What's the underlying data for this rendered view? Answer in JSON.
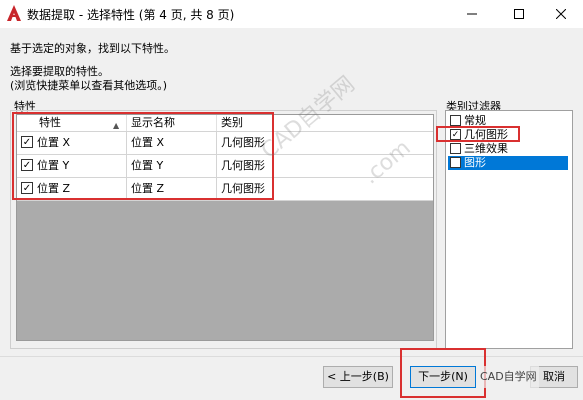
{
  "window": {
    "title": "数据提取 - 选择特性 (第 4 页, 共 8 页)"
  },
  "intro": {
    "line1": "基于选定的对象，找到以下特性。",
    "line2": "选择要提取的特性。",
    "line3": "(浏览快捷菜单以查看其他选项。)"
  },
  "properties": {
    "group_label": "特性",
    "headers": {
      "property": "特性",
      "display_name": "显示名称",
      "category": "类别"
    },
    "rows": [
      {
        "checked": true,
        "property": "位置 X",
        "display_name": "位置 X",
        "category": "几何图形"
      },
      {
        "checked": true,
        "property": "位置 Y",
        "display_name": "位置 Y",
        "category": "几何图形"
      },
      {
        "checked": true,
        "property": "位置 Z",
        "display_name": "位置 Z",
        "category": "几何图形"
      }
    ]
  },
  "category_filter": {
    "group_label": "类别过滤器",
    "items": [
      {
        "label": "常规",
        "checked": false,
        "selected": false
      },
      {
        "label": "几何图形",
        "checked": true,
        "selected": false
      },
      {
        "label": "三维效果",
        "checked": false,
        "selected": false
      },
      {
        "label": "图形",
        "checked": false,
        "selected": true
      }
    ]
  },
  "buttons": {
    "back": "< 上一步(B)",
    "next": "下一步(N)",
    "cancel": "取消"
  },
  "overlay": {
    "watermark": "CAD自学网",
    "watermark2": ".com",
    "brand": "CAD自学网"
  },
  "colors": {
    "annotation": "#d93030",
    "selection": "#0078d7",
    "grid_background": "#ababab"
  },
  "icons": {
    "sort": "triangle-up",
    "app": "autocad-a"
  }
}
